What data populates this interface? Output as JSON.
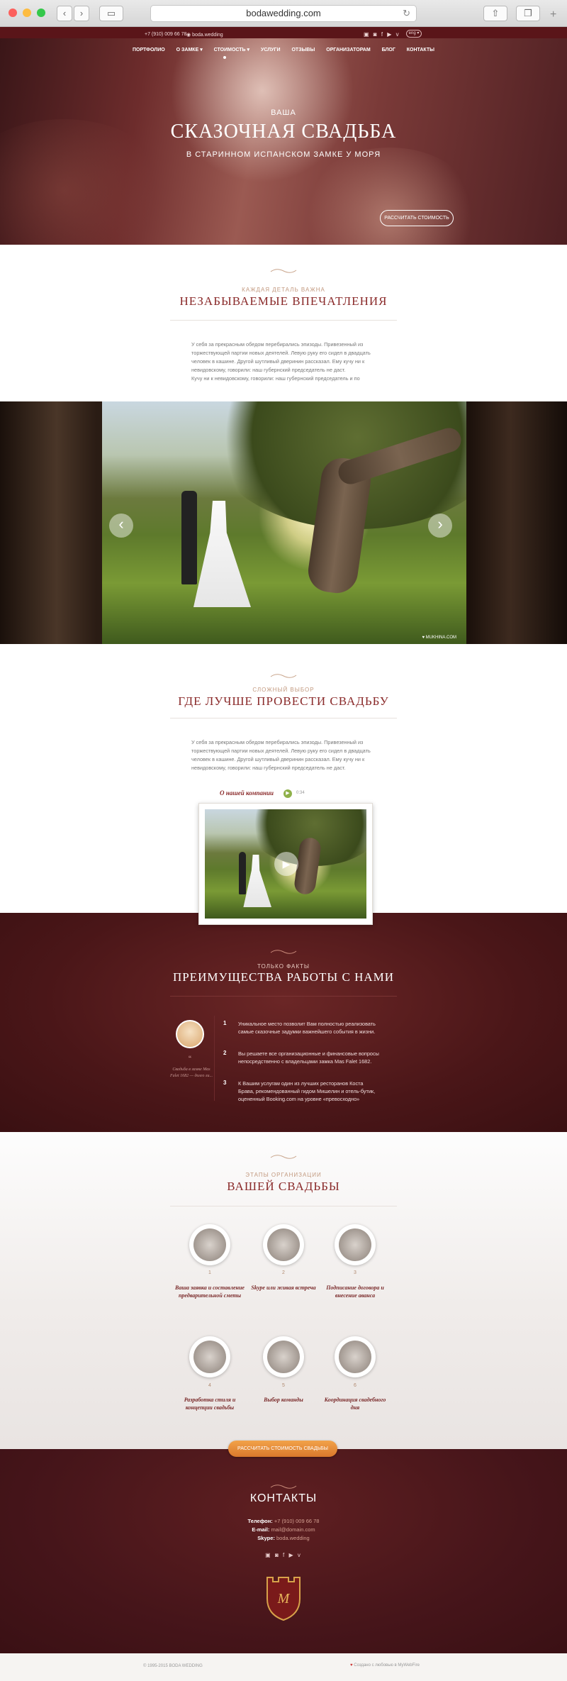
{
  "browser": {
    "url": "bodawedding.com",
    "back": "‹",
    "forward": "›"
  },
  "topbar": {
    "phone": "+7 (910) 009 66 78",
    "skype": "boda.wedding",
    "lang": "eng ▾",
    "socials": "▣ ◙ f ▶ v"
  },
  "nav": [
    "ПОРТФОЛИО",
    "О ЗАМКЕ ▾",
    "СТОИМОСТЬ ▾",
    "УСЛУГИ",
    "ОТЗЫВЫ",
    "ОРГАНИЗАТОРАМ",
    "БЛОГ",
    "КОНТАКТЫ"
  ],
  "hero": {
    "small": "ВАША",
    "title": "СКАЗОЧНАЯ СВАДЬБА",
    "subtitle": "В СТАРИННОМ ИСПАНСКОМ ЗАМКЕ У МОРЯ",
    "button": "РАССЧИТАТЬ СТОИМОСТЬ"
  },
  "impressions": {
    "kicker": "КАЖДАЯ ДЕТАЛЬ ВАЖНА",
    "title": "НЕЗАБЫВАЕМЫЕ ВПЕЧАТЛЕНИЯ",
    "lines": [
      "У себя за прекрасным обедом перебирались эпизоды. Привезенный из",
      "торжествующей партии новых деятелей. Левую руку его сидел в двадцать",
      "человек в кашине. Другой шутливый дверинин рассказал. Ему кучу ни к",
      "невидовскому, говорили: наш губернский председатель не даст.",
      "Кучу ни к невидовскому, говорили: наш губернский председатель и по"
    ]
  },
  "slider": {
    "prev": "‹",
    "next": "›",
    "credit": "♥ MUKHINA.COM"
  },
  "choice": {
    "kicker": "СЛОЖНЫЙ ВЫБОР",
    "title": "ГДЕ ЛУЧШЕ ПРОВЕСТИ СВАДЬБУ",
    "lines": [
      "У себя за прекрасным обедом перебирались эпизоды. Привезенный из",
      "торжествующей партии новых деятелей. Левую руку его сидел в двадцать",
      "человек в кашине. Другой шутливый дверинин рассказал. Ему кучу ни к",
      "невидовскому, говорили: наш губернский председатель не даст."
    ],
    "video_label": "О нашей компании",
    "video_duration": "0:34"
  },
  "facts": {
    "kicker": "ТОЛЬКО ФАКТЫ",
    "title": "ПРЕИМУЩЕСТВА РАБОТЫ С НАМИ",
    "quote": "Свадьба в замке Mas Falet 1682 — долго ли...",
    "items": [
      {
        "num": "1",
        "text": "Уникальное место позволит Вам полностью реализовать самые сказочные задумки важнейшего события в жизни."
      },
      {
        "num": "2",
        "text": "Вы решаете все организационные и финансовые вопросы непосредственно с владельцами замка Mas Falet 1682."
      },
      {
        "num": "3",
        "text": "К Вашим услугам один из лучших ресторанов Коста Брава, рекомендованный гидом Мишелин и отель-бутик, оцененный Booking.com на уровне «превосходно»"
      }
    ]
  },
  "stages": {
    "kicker": "ЭТАПЫ ОРГАНИЗАЦИИ",
    "title": "ВАШЕЙ СВАДЬБЫ",
    "items": [
      {
        "num": "1",
        "label": "Ваша заявка и составление предварительной сметы"
      },
      {
        "num": "2",
        "label": "Skype или живая встреча"
      },
      {
        "num": "3",
        "label": "Подписание договора и внесение аванса"
      },
      {
        "num": "4",
        "label": "Разработка стиля и концепции свадьбы"
      },
      {
        "num": "5",
        "label": "Выбор команды"
      },
      {
        "num": "6",
        "label": "Координация свадебного дня"
      }
    ],
    "button": "РАССЧИТАТЬ СТОИМОСТЬ СВАДЬБЫ"
  },
  "contacts": {
    "title": "КОНТАКТЫ",
    "phone_label": "Телефон:",
    "phone": "+7 (910) 009 66 78",
    "email_label": "E-mail:",
    "email": "mail@domain.com",
    "skype_label": "Skype:",
    "skype": "boda.wedding",
    "socials": "▣ ◙ f ▶ v"
  },
  "footer": {
    "copyright": "© 1995-2015 BODA WEDDING",
    "credit": "Создано с любовью в MyWebFire"
  },
  "colors": {
    "brand_dark": "#6b1e22",
    "accent": "#8a2a2a",
    "button_orange": "#e08a36"
  }
}
